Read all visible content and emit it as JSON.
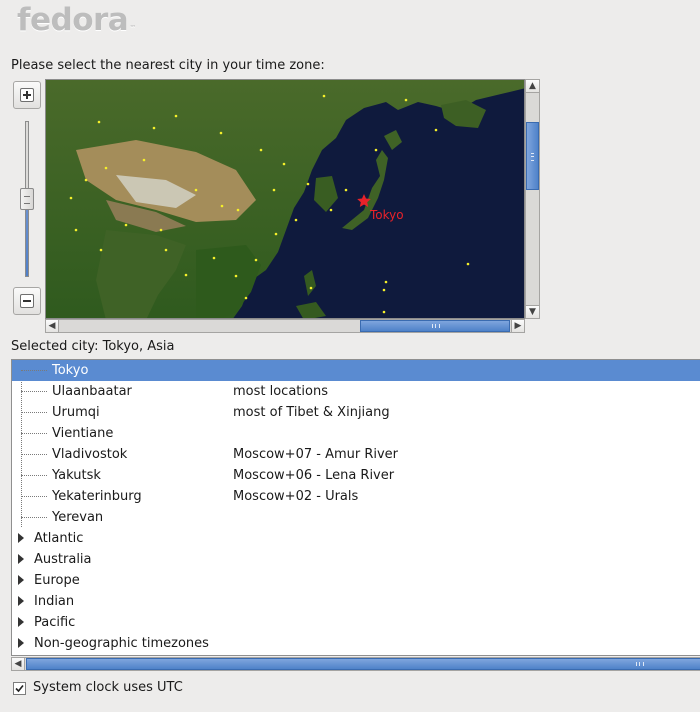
{
  "logo": {
    "text": "fedora",
    "tm": "™"
  },
  "prompt": "Please select the nearest city in your time zone:",
  "map": {
    "highlighted_city": "Tokyo",
    "marker_color": "#e8222a",
    "city_dot_color": "#f5f02a",
    "ocean_color": "#0f1a3d"
  },
  "zoom": {
    "in_icon": "zoom-in-icon",
    "out_icon": "zoom-out-icon"
  },
  "selected_city": "Selected city: Tokyo, Asia",
  "timezones": {
    "rows": [
      {
        "city": "Tokyo",
        "comment": "",
        "selected": true
      },
      {
        "city": "Ulaanbaatar",
        "comment": "most locations"
      },
      {
        "city": "Urumqi",
        "comment": "most of Tibet & Xinjiang"
      },
      {
        "city": "Vientiane",
        "comment": ""
      },
      {
        "city": "Vladivostok",
        "comment": "Moscow+07 - Amur River"
      },
      {
        "city": "Yakutsk",
        "comment": "Moscow+06 - Lena River"
      },
      {
        "city": "Yekaterinburg",
        "comment": "Moscow+02 - Urals"
      },
      {
        "city": "Yerevan",
        "comment": ""
      }
    ],
    "groups": [
      "Atlantic",
      "Australia",
      "Europe",
      "Indian",
      "Pacific",
      "Non-geographic timezones"
    ]
  },
  "utc": {
    "label": "System clock uses UTC",
    "checked": true
  },
  "colors": {
    "selection": "#5a8bd1",
    "scroll_thumb": "#4f82c9"
  }
}
